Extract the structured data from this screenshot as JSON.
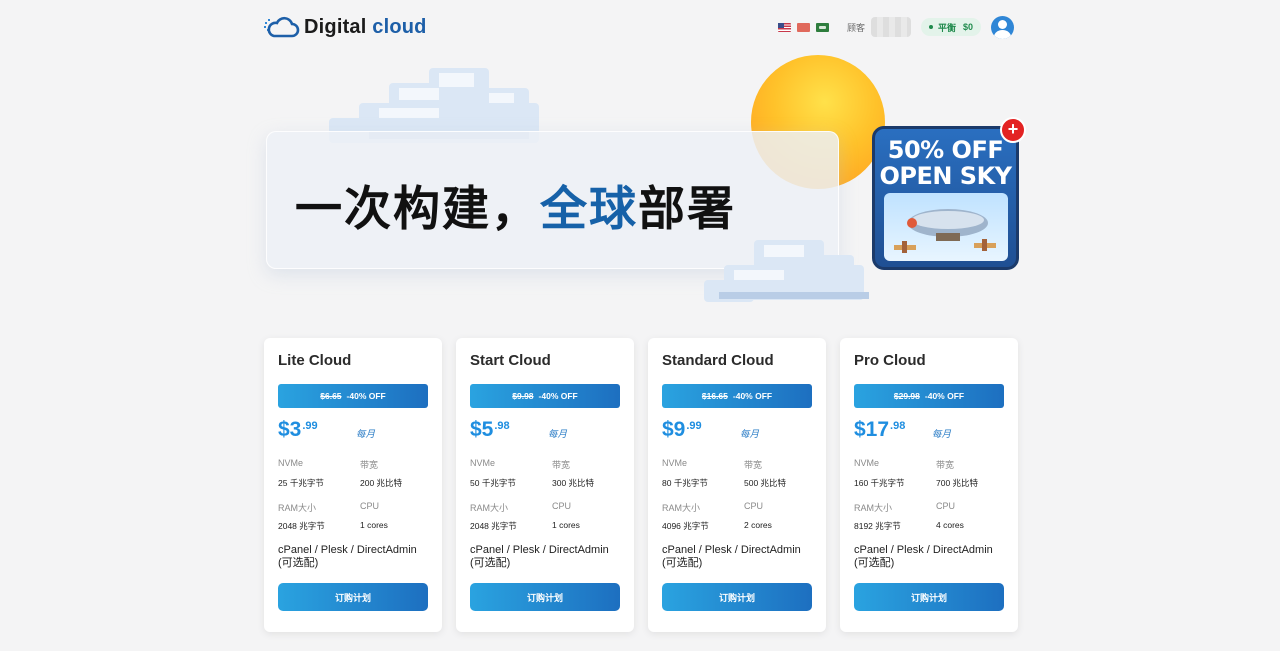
{
  "header": {
    "logo_dark": "Digital",
    "logo_blue": " cloud",
    "flags": [
      "us-flag",
      "cn-flag",
      "sa-flag"
    ],
    "guest_label": "顾客",
    "balance_label": "平衡",
    "balance_amount": "$0"
  },
  "hero": {
    "title_dark": "一次构建，",
    "title_blue": "全球",
    "title_dark2": "部署",
    "promo_line1": "50% OFF",
    "promo_line2": "OPEN SKY",
    "promo_plus": "+"
  },
  "labels": {
    "nvme": "NVMe",
    "bandwidth": "带宽",
    "ram": "RAM大小",
    "cpu": "CPU",
    "period": "每月",
    "panel": "cPanel / Plesk / DirectAdmin (可选配)",
    "order": "订购计划"
  },
  "plans": [
    {
      "name": "Lite Cloud",
      "old_price": "$6.65",
      "discount": "-40% OFF",
      "price_main": "$3",
      "price_cents": ".99",
      "nvme": "25 千兆字节",
      "bandwidth": "200 兆比特",
      "ram": "2048 兆字节",
      "cpu": "1 cores"
    },
    {
      "name": "Start Cloud",
      "old_price": "$9.98",
      "discount": "-40% OFF",
      "price_main": "$5",
      "price_cents": ".98",
      "nvme": "50 千兆字节",
      "bandwidth": "300 兆比特",
      "ram": "2048 兆字节",
      "cpu": "1 cores"
    },
    {
      "name": "Standard Cloud",
      "old_price": "$16.65",
      "discount": "-40% OFF",
      "price_main": "$9",
      "price_cents": ".99",
      "nvme": "80 千兆字节",
      "bandwidth": "500 兆比特",
      "ram": "4096 兆字节",
      "cpu": "2 cores"
    },
    {
      "name": "Pro Cloud",
      "old_price": "$29.98",
      "discount": "-40% OFF",
      "price_main": "$17",
      "price_cents": ".98",
      "nvme": "160 千兆字节",
      "bandwidth": "700 兆比特",
      "ram": "8192 兆字节",
      "cpu": "4 cores"
    }
  ],
  "colors": {
    "brand_blue": "#1d5fa8",
    "accent": "#1f8ee0",
    "balance_green": "#1f8a4c",
    "promo_red": "#e32323"
  }
}
